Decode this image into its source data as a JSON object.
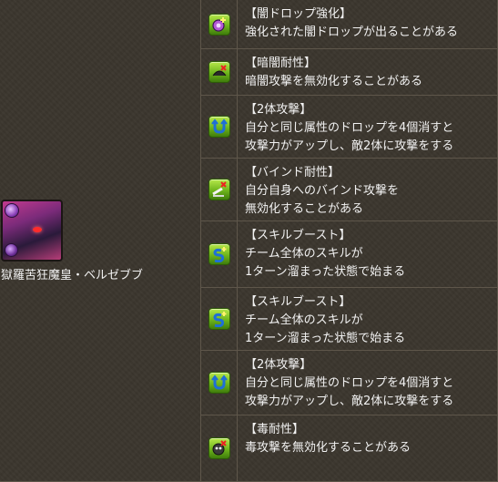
{
  "monster": {
    "name": "獄羅苦狂魔皇・ベルゼブブ"
  },
  "awakenings": [
    {
      "icon": "dark-orb-enhance-icon",
      "title": "【闇ドロップ強化】",
      "lines": [
        "強化された闇ドロップが出ることがある"
      ]
    },
    {
      "icon": "dark-resist-icon",
      "title": "【暗闇耐性】",
      "lines": [
        "暗闇攻撃を無効化することがある"
      ]
    },
    {
      "icon": "two-pronged-attack-icon",
      "title": "【2体攻撃】",
      "lines": [
        "自分と同じ属性のドロップを4個消すと",
        "攻撃力がアップし、敵2体に攻撃をする"
      ]
    },
    {
      "icon": "bind-resist-icon",
      "title": "【バインド耐性】",
      "lines": [
        "自分自身へのバインド攻撃を",
        "無効化することがある"
      ]
    },
    {
      "icon": "skill-boost-icon",
      "title": "【スキルブースト】",
      "lines": [
        "チーム全体のスキルが",
        "1ターン溜まった状態で始まる"
      ]
    },
    {
      "icon": "skill-boost-icon",
      "title": "【スキルブースト】",
      "lines": [
        "チーム全体のスキルが",
        "1ターン溜まった状態で始まる"
      ]
    },
    {
      "icon": "two-pronged-attack-icon",
      "title": "【2体攻撃】",
      "lines": [
        "自分と同じ属性のドロップを4個消すと",
        "攻撃力がアップし、敵2体に攻撃をする"
      ]
    },
    {
      "icon": "poison-resist-icon",
      "title": "【毒耐性】",
      "lines": [
        "毒攻撃を無効化することがある"
      ]
    }
  ]
}
